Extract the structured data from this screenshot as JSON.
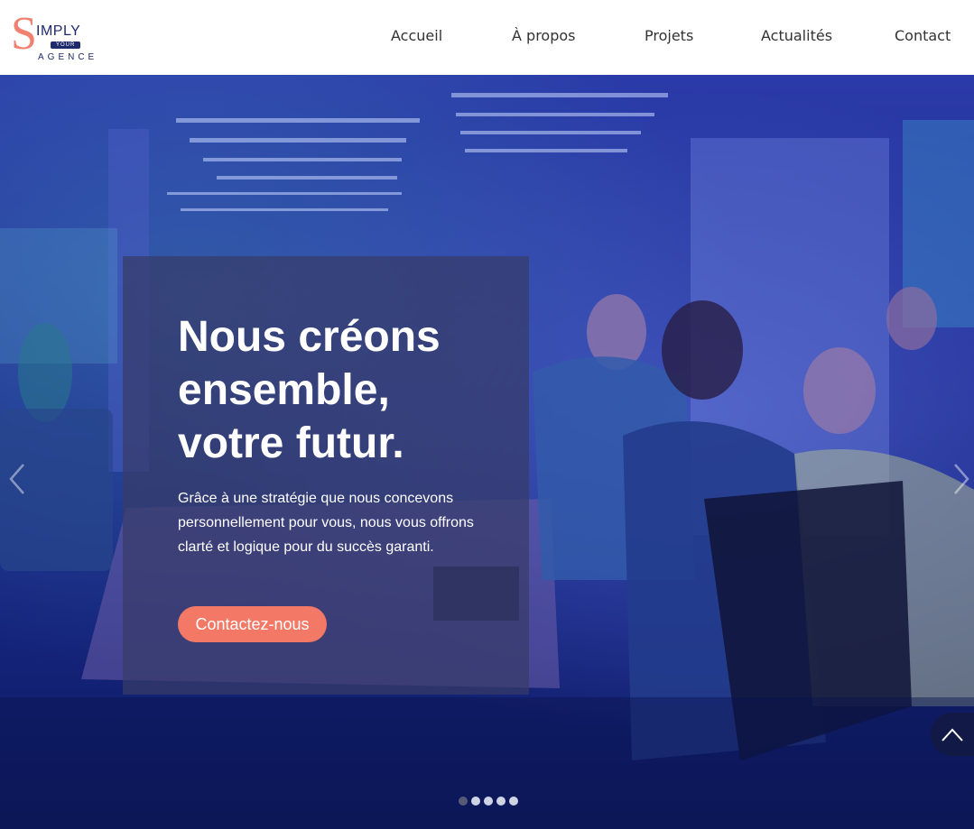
{
  "brand": {
    "logo_letter": "S",
    "logo_word": "IMPLY",
    "logo_tag": "YOUR",
    "logo_sub": "AGENCE",
    "accent_color": "#f37966",
    "navy_color": "#1f2a6b"
  },
  "nav": {
    "items": [
      {
        "label": "Accueil"
      },
      {
        "label": "À propos"
      },
      {
        "label": "Projets"
      },
      {
        "label": "Actualités"
      },
      {
        "label": "Contact"
      }
    ]
  },
  "hero": {
    "headline_line1": "Nous créons",
    "headline_line2": "ensemble,",
    "headline_line3": "votre futur.",
    "subtext": "Grâce à une stratégie que nous concevons personnellement pour vous, nous vous offrons clarté et logique pour du succès garanti.",
    "cta_label": "Contactez-nous",
    "slides_total": 5,
    "active_slide": 1
  },
  "icons": {
    "prev": "chevron-left-icon",
    "next": "chevron-right-icon",
    "scroll_top": "chevron-up-icon"
  }
}
